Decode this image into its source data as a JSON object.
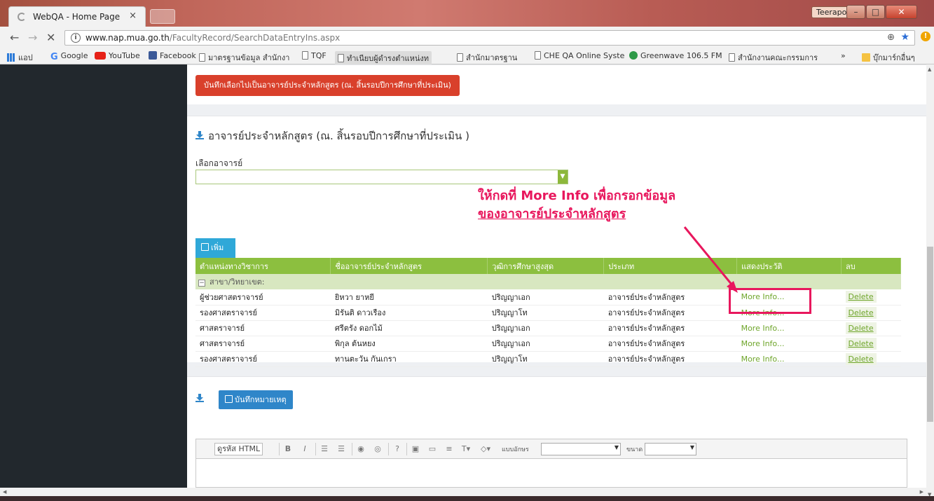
{
  "browser": {
    "tab_title": "WebQA - Home Page",
    "tab_close": "×",
    "user_name": "Teerapol",
    "win_min": "–",
    "win_max": "□",
    "win_close": "✕",
    "nav_back": "←",
    "nav_forward": "→",
    "nav_stop": "✕",
    "url_host": "www.nap.mua.go.th",
    "url_path": "/FacultyRecord/SearchDataEntryIns.aspx",
    "info_icon": "i",
    "zoom_icon": "⊕",
    "star_icon": "★",
    "ext_icon": "!",
    "bookmarks": [
      {
        "label": "แอป",
        "icon": "apps-icon"
      },
      {
        "label": "Google",
        "icon": "google-icon"
      },
      {
        "label": "YouTube",
        "icon": "youtube-icon"
      },
      {
        "label": "Facebook",
        "icon": "facebook-icon"
      },
      {
        "label": "มาตรฐานข้อมูล สำนักงา",
        "icon": "page-icon"
      },
      {
        "label": "TQF",
        "icon": "page-icon"
      },
      {
        "label": "ทำเนียบผู้ดำรงตำแหน่งท",
        "icon": "page-icon"
      },
      {
        "label": "สำนักมาตรฐาน",
        "icon": "page-icon"
      },
      {
        "label": "CHE QA Online Syste",
        "icon": "page-icon"
      },
      {
        "label": "Greenwave 106.5 FM",
        "icon": "greenwave-icon"
      },
      {
        "label": "สำนักงานคณะกรรมการ",
        "icon": "page-icon"
      },
      {
        "label": "»",
        "icon": "chevron-right-icon"
      },
      {
        "label": "บุ๊กมาร์กอื่นๆ",
        "icon": "folder-icon"
      }
    ]
  },
  "top_panel": {
    "save_selected_button": "บันทึกเลือกไปเป็นอาจารย์ประจำหลักสูตร (ณ. สิ้นรอบปีการศึกษาที่ประเมิน)"
  },
  "faculty_panel": {
    "title": "อาจารย์ประจำหลักสูตร (ณ. สิ้นรอบปีการศึกษาที่ประเมิน )",
    "select_label": "เลือกอาจารย์",
    "select_value": "",
    "add_button": "เพิ่ม",
    "columns": [
      "ตำแหน่งทางวิชาการ",
      "ชื่ออาจารย์ประจำหลักสูตร",
      "วุฒิการศึกษาสูงสุด",
      "ประเภท",
      "แสดงประวัติ",
      "ลบ"
    ],
    "group_label": "สาขา/วิทยาเขต:",
    "group_toggle": "−",
    "rows": [
      {
        "position": "ผู้ช่วยศาสตราจารย์",
        "name": "ยิหวา ยาหยี",
        "degree": "ปริญญาเอก",
        "type": "อาจารย์ประจำหลักสูตร",
        "info": "More Info...",
        "delete": "Delete"
      },
      {
        "position": "รองศาสตราจารย์",
        "name": "มิรันติ ดาวเรือง",
        "degree": "ปริญญาโท",
        "type": "อาจารย์ประจำหลักสูตร",
        "info": "More Info...",
        "delete": "Delete"
      },
      {
        "position": "ศาสตราจารย์",
        "name": "ศรีตรัง ดอกไม้",
        "degree": "ปริญญาเอก",
        "type": "อาจารย์ประจำหลักสูตร",
        "info": "More Info...",
        "delete": "Delete"
      },
      {
        "position": "ศาสตราจารย์",
        "name": "พิกุล ต้นหยง",
        "degree": "ปริญญาเอก",
        "type": "อาจารย์ประจำหลักสูตร",
        "info": "More Info...",
        "delete": "Delete"
      },
      {
        "position": "รองศาสตราจารย์",
        "name": "ทานตะวัน กันเกรา",
        "degree": "ปริญญาโท",
        "type": "อาจารย์ประจำหลักสูตร",
        "info": "More Info...",
        "delete": "Delete"
      }
    ]
  },
  "annotation": {
    "line1": "ให้กดที่ More Info เพื่อกรอกข้อมูล",
    "line2": "ของอาจารย์ประจำหลักสูตร",
    "color": "#e8175d"
  },
  "note_panel": {
    "save_note_button": "บันทึกหมายเหตุ",
    "toolbar": {
      "html_code": "ดูรหัส HTML",
      "bold": "B",
      "italic": "I",
      "font_label": "แบบอักษร",
      "size_label": "ขนาด",
      "font_value": "",
      "size_value": ""
    }
  },
  "colors": {
    "accent_green": "#8cbf3f",
    "danger_red": "#d9402b",
    "primary_blue": "#2f86c9",
    "sidebar": "#22282d"
  }
}
